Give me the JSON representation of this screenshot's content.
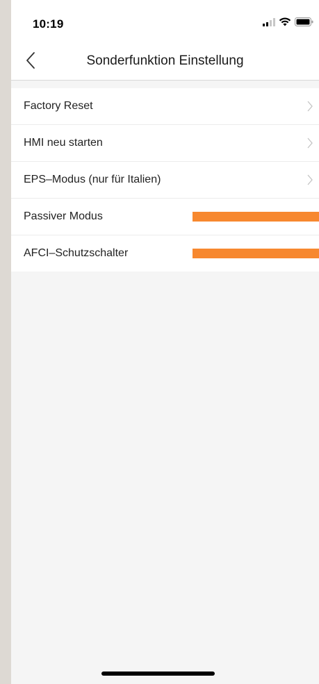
{
  "status_bar": {
    "time": "10:19",
    "icons": [
      "signal-icon",
      "wifi-icon",
      "battery-icon"
    ]
  },
  "nav": {
    "title": "Sonderfunktion Einstellung",
    "back_icon": "chevron-left-icon"
  },
  "list": {
    "items": [
      {
        "label": "Factory Reset",
        "trailing": "chevron-right-icon"
      },
      {
        "label": "HMI neu starten",
        "trailing": "chevron-right-icon"
      },
      {
        "label": "EPS–Modus (nur für Italien)",
        "trailing": "chevron-right-icon"
      },
      {
        "label": "Passiver Modus",
        "trailing": "orange-bar"
      },
      {
        "label": "AFCI–Schutzschalter",
        "trailing": "orange-bar"
      }
    ]
  },
  "colors": {
    "accent_orange": "#f7882f",
    "background": "#f5f5f5",
    "outer_background": "#ddd9d3"
  }
}
